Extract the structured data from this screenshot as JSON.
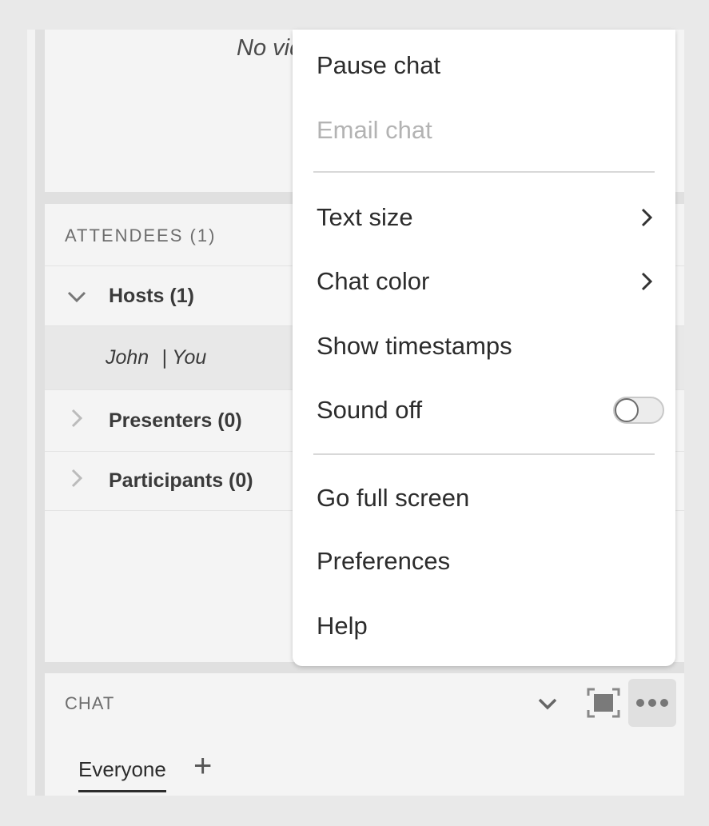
{
  "video": {
    "no_video_text": "No video"
  },
  "attendees": {
    "header": "ATTENDEES  (1)",
    "groups": [
      {
        "label": "Hosts (1)",
        "expanded": true
      },
      {
        "label": "Presenters (0)",
        "expanded": false
      },
      {
        "label": "Participants (0)",
        "expanded": false
      }
    ],
    "host_member": {
      "name": "John",
      "suffix": "| You"
    }
  },
  "chat": {
    "header": "CHAT",
    "tab": "Everyone",
    "add_tab": "+"
  },
  "menu": {
    "items": {
      "pause": "Pause chat",
      "email": "Email chat",
      "text_size": "Text size",
      "chat_color": "Chat color",
      "timestamps": "Show timestamps",
      "sound": "Sound off",
      "fullscreen": "Go full screen",
      "preferences": "Preferences",
      "help": "Help"
    },
    "sound_toggle_on": false,
    "email_disabled": true
  }
}
